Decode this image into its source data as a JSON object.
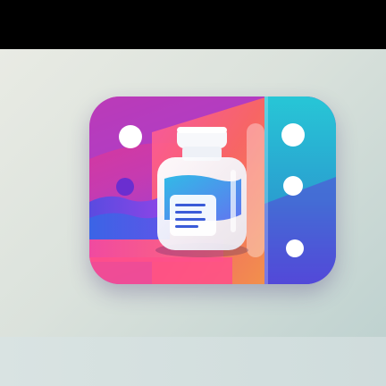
{
  "icon": {
    "name": "medicine-bottle-icon",
    "colors": {
      "magenta": "#e2358f",
      "purple": "#7a3fe0",
      "teal": "#1fb7c9",
      "orange": "#ff7a3a",
      "bottle_glass": "#f4f6fb",
      "label_lines": "#3a5bd8"
    }
  }
}
